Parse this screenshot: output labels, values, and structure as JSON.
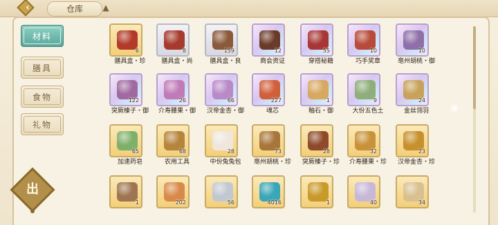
{
  "header": {
    "back_icon": "chevron-left-icon",
    "title": "仓库",
    "star_icon": "star-icon"
  },
  "sidebar": {
    "tabs": [
      {
        "label": "材料",
        "active": true
      },
      {
        "label": "膳具",
        "active": false
      },
      {
        "label": "食物",
        "active": false
      },
      {
        "label": "礼物",
        "active": false
      }
    ],
    "out_button_label": "出"
  },
  "items": [
    {
      "name": "膳具盒・珍",
      "count": "6",
      "rarity": "gold",
      "icon": "red-box-icon",
      "color": "#b23a2a"
    },
    {
      "name": "膳具盒・尚",
      "count": "8",
      "rarity": "common",
      "icon": "red-box-icon",
      "color": "#a63a2d"
    },
    {
      "name": "膳具盒・良",
      "count": "159",
      "rarity": "common",
      "icon": "brown-box-icon",
      "color": "#8a5a3a"
    },
    {
      "name": "商会资证",
      "count": "12",
      "rarity": "rare",
      "icon": "certificate-icon",
      "color": "#6b3b2a"
    },
    {
      "name": "穿搭秘籍",
      "count": "55",
      "rarity": "rare",
      "icon": "book-icon",
      "color": "#a83636"
    },
    {
      "name": "巧手奖章",
      "count": "10",
      "rarity": "rare",
      "icon": "medal-icon",
      "color": "#b84a3a"
    },
    {
      "name": "亳州胡桃・御",
      "count": "10",
      "rarity": "rare",
      "icon": "walnut-icon",
      "color": "#8e6fa8"
    },
    {
      "name": "突厥榛子・御",
      "count": "122",
      "rarity": "rare",
      "icon": "hazelnut-icon",
      "color": "#a06aa0"
    },
    {
      "name": "介寿腰果・御",
      "count": "26",
      "rarity": "rare",
      "icon": "cashew-icon",
      "color": "#c07ab8"
    },
    {
      "name": "汉帝金杏・御",
      "count": "66",
      "rarity": "rare",
      "icon": "apricot-icon",
      "color": "#b88ac8"
    },
    {
      "name": "魂芯",
      "count": "227",
      "rarity": "rare",
      "icon": "soul-core-icon",
      "color": "#d0603a"
    },
    {
      "name": "釉石・御",
      "count": "1",
      "rarity": "rare",
      "icon": "glaze-stone-icon",
      "color": "#d6a860"
    },
    {
      "name": "大份五色土",
      "count": "9",
      "rarity": "rare",
      "icon": "soil-pot-icon",
      "color": "#8fae7a"
    },
    {
      "name": "金丝翎羽",
      "count": "24",
      "rarity": "rare",
      "icon": "feather-icon",
      "color": "#c8a25a"
    },
    {
      "name": "加速药皂",
      "count": "65",
      "rarity": "gold",
      "icon": "soap-icon",
      "color": "#7fb06a"
    },
    {
      "name": "农用工具",
      "count": "68",
      "rarity": "gold",
      "icon": "tool-chest-icon",
      "color": "#b6843c"
    },
    {
      "name": "中份兔兔包",
      "count": "28",
      "rarity": "gold",
      "icon": "bun-icon",
      "color": "#efe6de"
    },
    {
      "name": "亳州胡桃・珍",
      "count": "73",
      "rarity": "gold",
      "icon": "walnut-icon",
      "color": "#a8763a"
    },
    {
      "name": "突厥榛子・珍",
      "count": "28",
      "rarity": "gold",
      "icon": "hazelnut-icon",
      "color": "#8e4a2a"
    },
    {
      "name": "介寿腰果・珍",
      "count": "32",
      "rarity": "gold",
      "icon": "cashew-icon",
      "color": "#c8923a"
    },
    {
      "name": "汉帝金杏・珍",
      "count": "23",
      "rarity": "gold",
      "icon": "apricot-icon",
      "color": "#c7902e"
    },
    {
      "name": "",
      "count": "1",
      "rarity": "gold",
      "icon": "cloth-bundle-icon",
      "color": "#9e7550"
    },
    {
      "name": "",
      "count": "202",
      "rarity": "gold",
      "icon": "recipe-scroll-icon",
      "color": "#d98a4a"
    },
    {
      "name": "",
      "count": "56",
      "rarity": "gold",
      "icon": "bowl-icon",
      "color": "#c0c8d0"
    },
    {
      "name": "",
      "count": "4016",
      "rarity": "gold",
      "icon": "ticket-icon",
      "color": "#3aa6b8"
    },
    {
      "name": "",
      "count": "1",
      "rarity": "gold",
      "icon": "gold-ticket-icon",
      "color": "#c79a2a"
    },
    {
      "name": "",
      "count": "40",
      "rarity": "gold",
      "icon": "potion-bottle-icon",
      "color": "#c8b8d8"
    },
    {
      "name": "",
      "count": "34",
      "rarity": "gold",
      "icon": "building-card-icon",
      "color": "#d8c090"
    }
  ]
}
